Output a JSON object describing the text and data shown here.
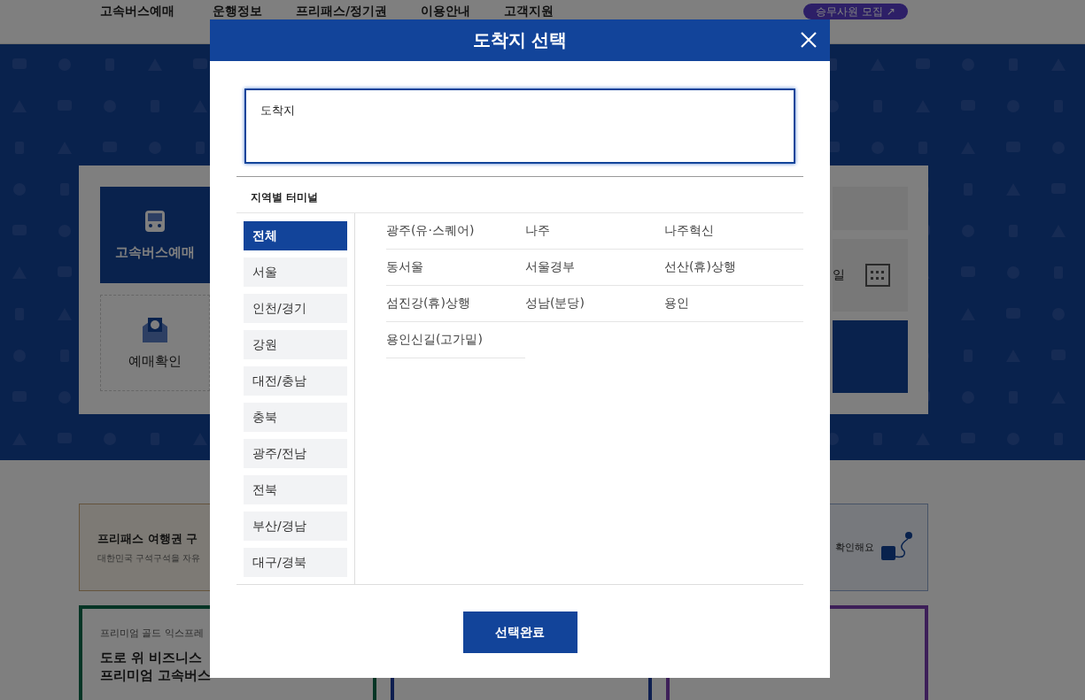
{
  "header": {
    "logo": "고속버스예매",
    "nav": [
      "운행정보",
      "프리패스/정기권",
      "이용안내",
      "고객지원"
    ],
    "recruit_button": "승무사원 모집 ↗"
  },
  "booking_panel": {
    "tabs": [
      {
        "label": "고속버스예매",
        "selected": true
      },
      {
        "label": "예매확인",
        "selected": false
      }
    ],
    "date_text": "일"
  },
  "promo": {
    "freepass_title": "프리패스 여행권 구",
    "freepass_desc": "대한민국 구석구석을 자유",
    "tracking_text": "확인해요"
  },
  "premium_card": {
    "eyebrow": "프리미엄 골드 익스프레",
    "title_lines": [
      "도로 위 비즈니스",
      "프리미엄 고속버스"
    ]
  },
  "modal": {
    "title": "도착지 선택",
    "search": {
      "placeholder": "도착지"
    },
    "section_title": "지역별 터미널",
    "regions": [
      {
        "label": "전체",
        "selected": true
      },
      {
        "label": "서울",
        "selected": false
      },
      {
        "label": "인천/경기",
        "selected": false
      },
      {
        "label": "강원",
        "selected": false
      },
      {
        "label": "대전/충남",
        "selected": false
      },
      {
        "label": "충북",
        "selected": false
      },
      {
        "label": "광주/전남",
        "selected": false
      },
      {
        "label": "전북",
        "selected": false
      },
      {
        "label": "부산/경남",
        "selected": false
      },
      {
        "label": "대구/경북",
        "selected": false
      }
    ],
    "terminals": [
      "광주(유·스퀘어)",
      "나주",
      "나주혁신",
      "동서울",
      "서울경부",
      "선산(휴)상행",
      "섬진강(휴)상행",
      "성남(분당)",
      "용인",
      "용인신길(고가밑)"
    ],
    "confirm_button": "선택완료"
  }
}
